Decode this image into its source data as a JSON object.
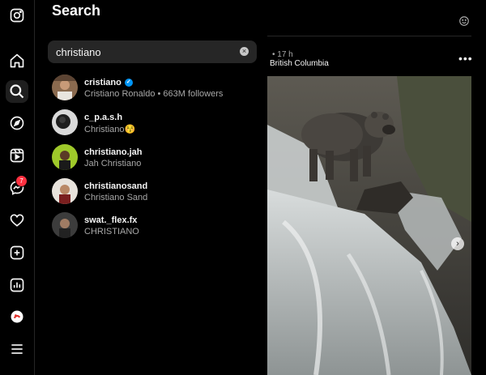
{
  "search": {
    "title": "Search",
    "query": "christiano",
    "results": [
      {
        "username": "cristiano",
        "verified": true,
        "subtitle": "Cristiano Ronaldo • 663M followers"
      },
      {
        "username": "c_p.a.s.h",
        "verified": false,
        "subtitle": "Christiano😚"
      },
      {
        "username": "christiano.jah",
        "verified": false,
        "subtitle": "Jah Christiano"
      },
      {
        "username": "christianosand",
        "verified": false,
        "subtitle": "Christiano Sand"
      },
      {
        "username": "swat._flex.fx",
        "verified": false,
        "subtitle": "CHRISTIANO"
      }
    ]
  },
  "nav": {
    "icons": [
      "instagram-logo-icon",
      "home-icon",
      "search-icon",
      "explore-icon",
      "reels-icon",
      "messenger-icon",
      "notifications-heart-icon",
      "create-plus-icon",
      "dashboard-icon",
      "profile-avatar",
      "menu-icon"
    ],
    "messages_badge": "7"
  },
  "post": {
    "time": "• 17 h",
    "location": "British Columbia",
    "more": "•••"
  },
  "colors": {
    "accent_blue": "#0095f6",
    "badge_red": "#ff3040",
    "panel_bg": "#000000",
    "input_bg": "#262626"
  }
}
